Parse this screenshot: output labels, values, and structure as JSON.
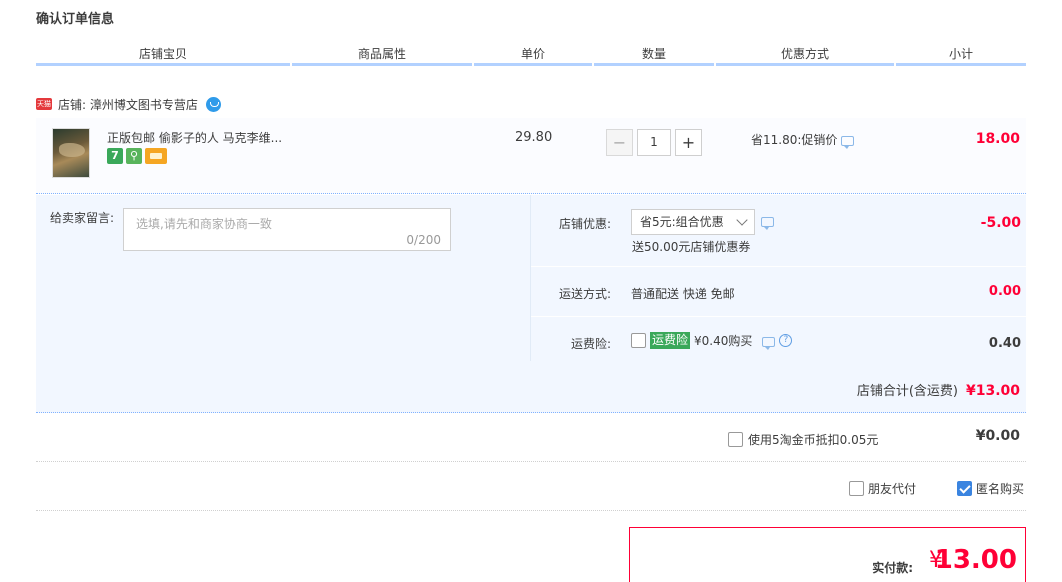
{
  "page_title": "确认订单信息",
  "columns": [
    "店铺宝贝",
    "商品属性",
    "单价",
    "数量",
    "优惠方式",
    "小计"
  ],
  "store": {
    "badge": "天猫",
    "label": "店铺: 漳州博文图书专营店"
  },
  "item": {
    "title": "正版包邮 偷影子的人 马克李维...",
    "badges": [
      "7"
    ],
    "unit_price": "29.80",
    "qty_minus": "−",
    "qty_value": "1",
    "qty_plus": "+",
    "promo": "省11.80:促销价",
    "subtotal": "18.00"
  },
  "message": {
    "label": "给卖家留言:",
    "placeholder": "选填,请先和商家协商一致",
    "count": "0/200"
  },
  "store_discount": {
    "label": "店铺优惠:",
    "selected": "省5元:组合优惠",
    "note": "送50.00元店铺优惠券",
    "value": "-5.00"
  },
  "shipping": {
    "label": "运送方式:",
    "text": "普通配送 快递 免邮",
    "value": "0.00"
  },
  "insurance": {
    "label": "运费险:",
    "tag": "运费险",
    "text": "¥0.40购买",
    "value": "0.40"
  },
  "store_total": {
    "label": "店铺合计(含运费)",
    "value": "¥13.00"
  },
  "coins": {
    "label": "使用5淘金币抵扣0.05元",
    "value": "¥0.00"
  },
  "options": {
    "friend_pay": "朋友代付",
    "anonymous": "匿名购买"
  },
  "payment": {
    "label": "实付款:",
    "currency": "¥",
    "amount": "13.00"
  },
  "colors": {
    "accent": "#ff0036",
    "header_line": "#b2d1ff",
    "panel_bg": "#f2f7ff"
  }
}
